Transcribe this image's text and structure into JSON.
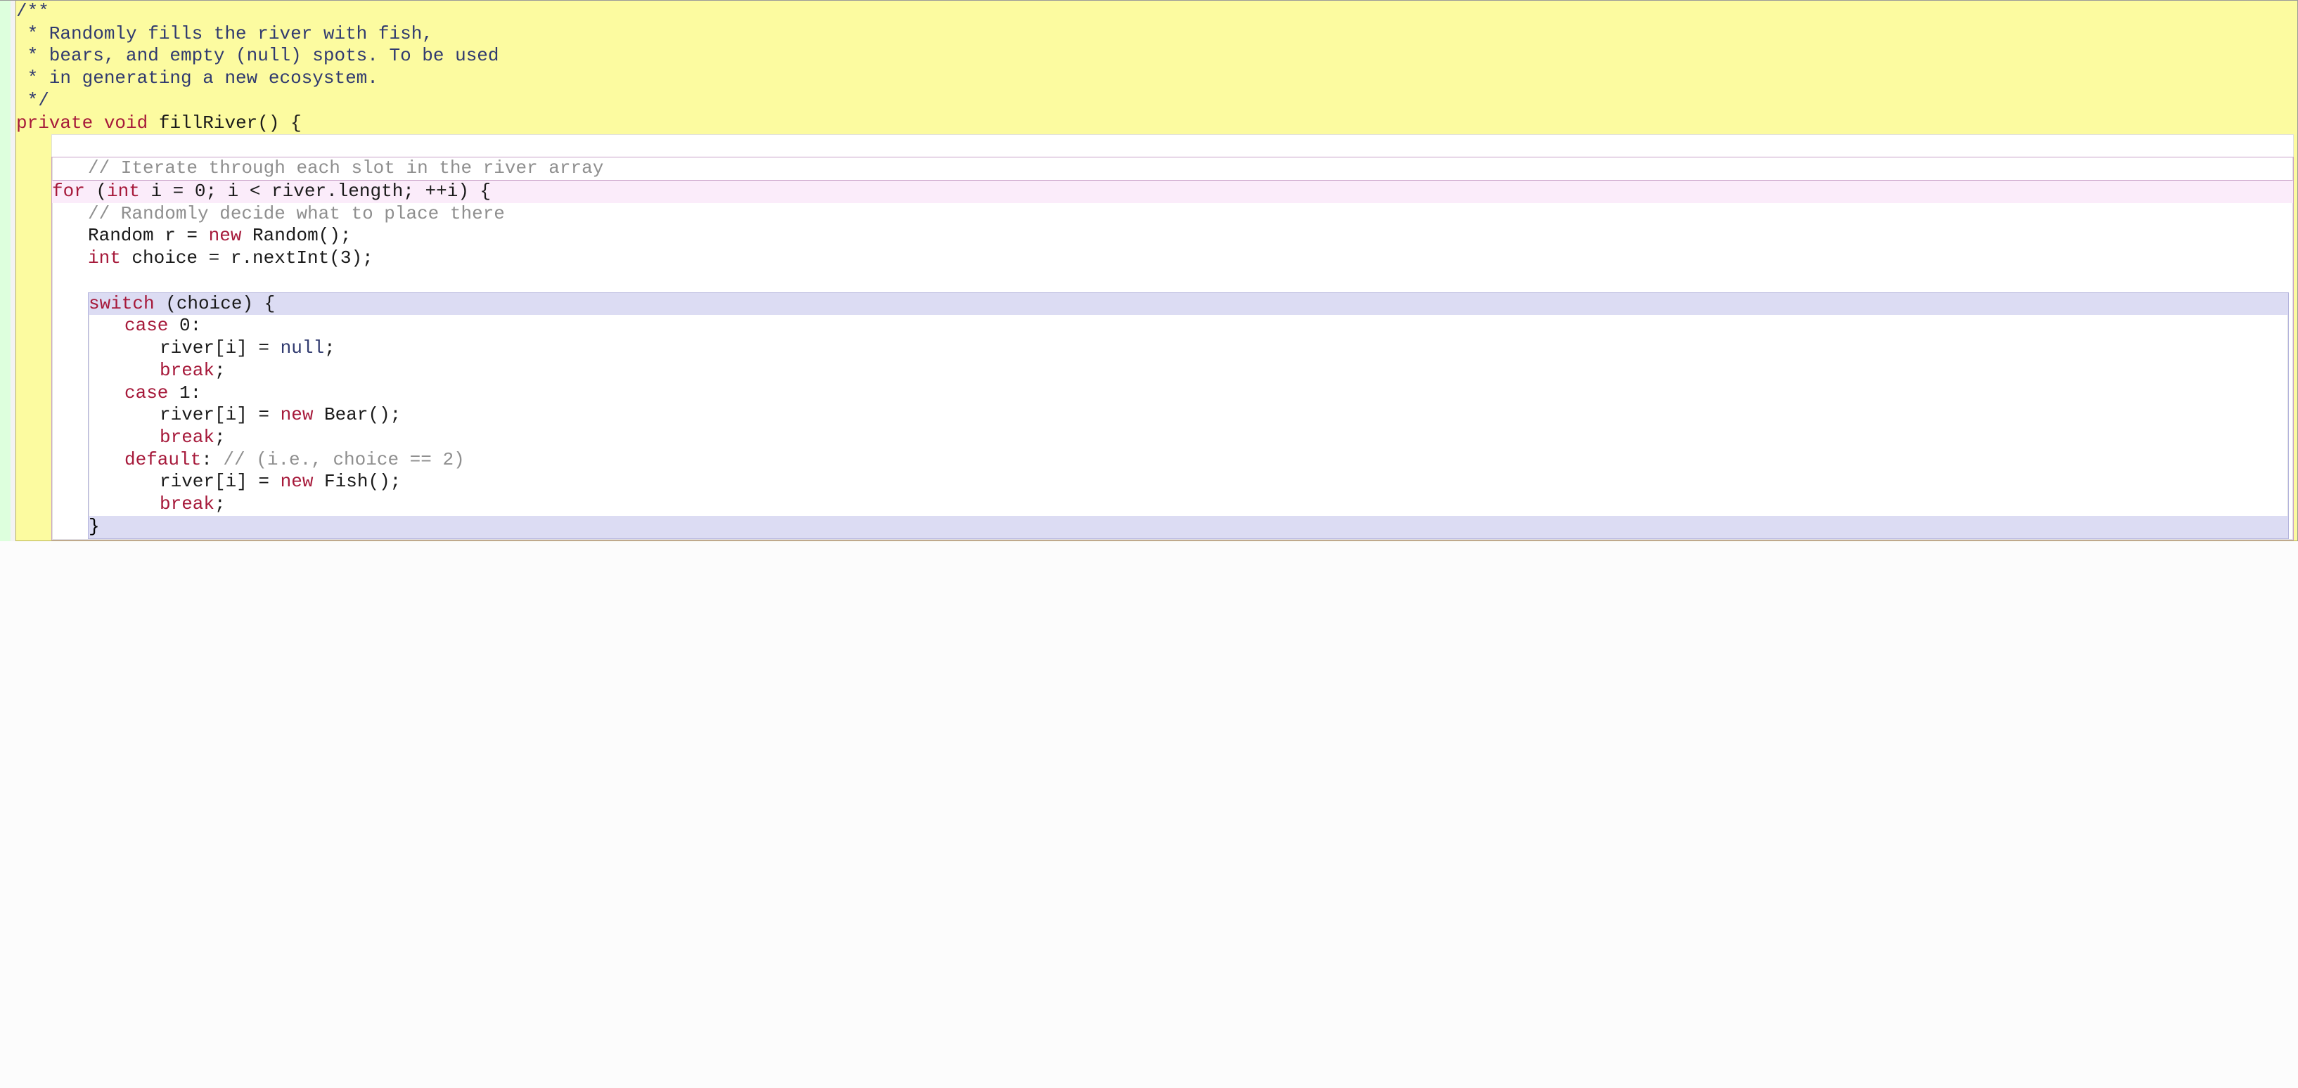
{
  "javadoc": {
    "l1": "/**",
    "l2": " * Randomly fills the river with fish,",
    "l3": " * bears, and empty (null) spots. To be used",
    "l4": " * in generating a new ecosystem.",
    "l5": " */"
  },
  "method": {
    "private": "private",
    "void": "void",
    "name": " fillRiver",
    "open": "() {"
  },
  "blank": " ",
  "comment_iterate": "// Iterate through each slot in the river array",
  "for_hdr": {
    "for": "for",
    "sp1": " (",
    "int": "int",
    "rest": " i = 0; i < river.length; ++i) {"
  },
  "comment_randomly": "// Randomly decide what to place there",
  "random_line": {
    "a": "Random r = ",
    "new": "new",
    "b": " Random();"
  },
  "choice_line": {
    "int": "int",
    "rest": " choice = r.nextInt(3);"
  },
  "switch_hdr": {
    "switch": "switch",
    "rest": " (choice) {"
  },
  "case0": {
    "case": "case",
    "rest": " 0:"
  },
  "case0_body1a": "river[i] = ",
  "case0_body1b": "null",
  "case0_body1c": ";",
  "break": "break",
  "semi": ";",
  "case1": {
    "case": "case",
    "rest": " 1:"
  },
  "case1_body1a": "river[i] = ",
  "case1_body1b": "new",
  "case1_body1c": " Bear();",
  "default_kw": "default",
  "default_colon": ":",
  "default_comment": " // (i.e., choice == 2)",
  "def_body1a": "river[i] = ",
  "def_body1b": "new",
  "def_body1c": " Fish();",
  "close_brace": "}"
}
